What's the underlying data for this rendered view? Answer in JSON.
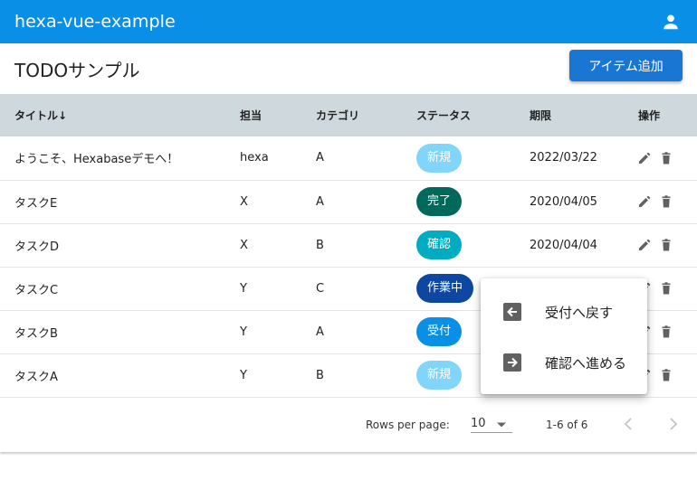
{
  "appbar": {
    "title": "hexa-vue-example",
    "account_icon": "account-icon"
  },
  "page": {
    "title": "TODOサンプル",
    "add_button": "アイテム追加"
  },
  "colors": {
    "appbar": "#0a8fe6",
    "header_bg": "#cfd8dc",
    "button": "#1976d2"
  },
  "table": {
    "headers": [
      "タイトル↓",
      "担当",
      "カテゴリ",
      "ステータス",
      "期限",
      "操作"
    ],
    "rows": [
      {
        "title": "ようこそ、Hexabaseデモへ！",
        "assignee": "hexa",
        "category": "A",
        "status": "新規",
        "status_color": "#81d4fa",
        "due": "2022/03/22"
      },
      {
        "title": "タスクE",
        "assignee": "X",
        "category": "A",
        "status": "完了",
        "status_color": "#00695c",
        "due": "2020/04/05"
      },
      {
        "title": "タスクD",
        "assignee": "X",
        "category": "B",
        "status": "確認",
        "status_color": "#00acc1",
        "due": "2020/04/04"
      },
      {
        "title": "タスクC",
        "assignee": "Y",
        "category": "C",
        "status": "作業中",
        "status_color": "#0d47a1",
        "due": ""
      },
      {
        "title": "タスクB",
        "assignee": "Y",
        "category": "A",
        "status": "受付",
        "status_color": "#0a8fe6",
        "due": ""
      },
      {
        "title": "タスクA",
        "assignee": "Y",
        "category": "B",
        "status": "新規",
        "status_color": "#81d4fa",
        "due": ""
      }
    ]
  },
  "footer": {
    "rows_per_page_label": "Rows per page:",
    "rows_per_page_value": "10",
    "range": "1-6 of 6"
  },
  "context_menu": {
    "items": [
      {
        "label": "受付へ戻す",
        "icon": "arrow-left-box-icon"
      },
      {
        "label": "確認へ進める",
        "icon": "arrow-right-box-icon"
      }
    ]
  }
}
